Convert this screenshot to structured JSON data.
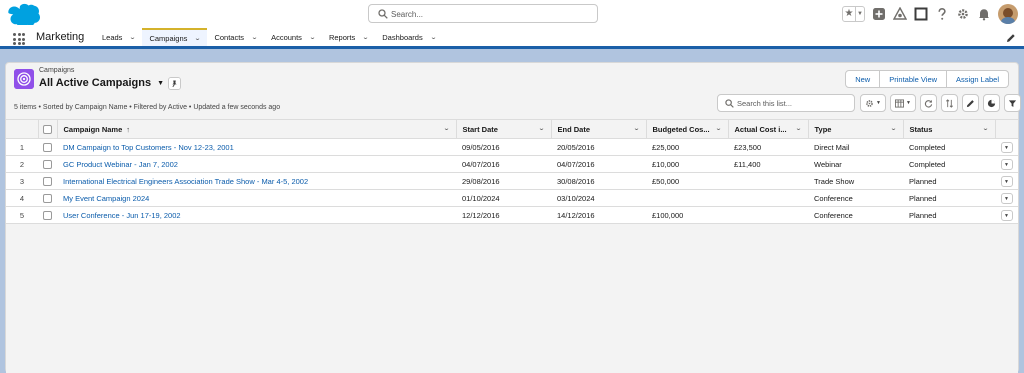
{
  "global_header": {
    "search_placeholder": "Search...",
    "icons": [
      "salesforce-cloud-icon",
      "search-icon",
      "favorites-star-icon",
      "favorites-dropdown-icon",
      "add-icon",
      "trailhead-icon",
      "help-square-icon",
      "help-icon",
      "setup-gear-icon",
      "notifications-bell-icon",
      "user-avatar"
    ]
  },
  "app_nav": {
    "app_name": "Marketing",
    "items": [
      {
        "label": "Leads",
        "active": false
      },
      {
        "label": "Campaigns",
        "active": true
      },
      {
        "label": "Contacts",
        "active": false
      },
      {
        "label": "Accounts",
        "active": false
      },
      {
        "label": "Reports",
        "active": false
      },
      {
        "label": "Dashboards",
        "active": false
      }
    ]
  },
  "list_view": {
    "object_label": "Campaigns",
    "title": "All Active Campaigns",
    "meta": "5 items • Sorted by Campaign Name • Filtered by Active • Updated a few seconds ago",
    "buttons": [
      "New",
      "Printable View",
      "Assign Label"
    ],
    "search_placeholder": "Search this list...",
    "columns": [
      "Campaign Name",
      "Start Date",
      "End Date",
      "Budgeted Cos...",
      "Actual Cost i...",
      "Type",
      "Status"
    ],
    "sort_indicator": "↑",
    "rows": [
      {
        "num": "1",
        "name": "DM Campaign to Top Customers - Nov 12-23, 2001",
        "start": "09/05/2016",
        "end": "20/05/2016",
        "budget": "£25,000",
        "actual": "£23,500",
        "type": "Direct Mail",
        "status": "Completed"
      },
      {
        "num": "2",
        "name": "GC Product Webinar - Jan 7, 2002",
        "start": "04/07/2016",
        "end": "04/07/2016",
        "budget": "£10,000",
        "actual": "£11,400",
        "type": "Webinar",
        "status": "Completed"
      },
      {
        "num": "3",
        "name": "International Electrical Engineers Association Trade Show - Mar 4-5, 2002",
        "start": "29/08/2016",
        "end": "30/08/2016",
        "budget": "£50,000",
        "actual": "",
        "type": "Trade Show",
        "status": "Planned"
      },
      {
        "num": "4",
        "name": "My Event Campaign 2024",
        "start": "01/10/2024",
        "end": "03/10/2024",
        "budget": "",
        "actual": "",
        "type": "Conference",
        "status": "Planned"
      },
      {
        "num": "5",
        "name": "User Conference - Jun 17-19, 2002",
        "start": "12/12/2016",
        "end": "14/12/2016",
        "budget": "£100,000",
        "actual": "",
        "type": "Conference",
        "status": "Planned"
      }
    ]
  },
  "colors": {
    "brand_blue": "#0b5cab",
    "header_band": "#1b5fa8",
    "active_tab_accent": "#d4b22b",
    "campaign_icon_bg": "#9050e9",
    "salesforce_cloud": "#00a1e0"
  }
}
